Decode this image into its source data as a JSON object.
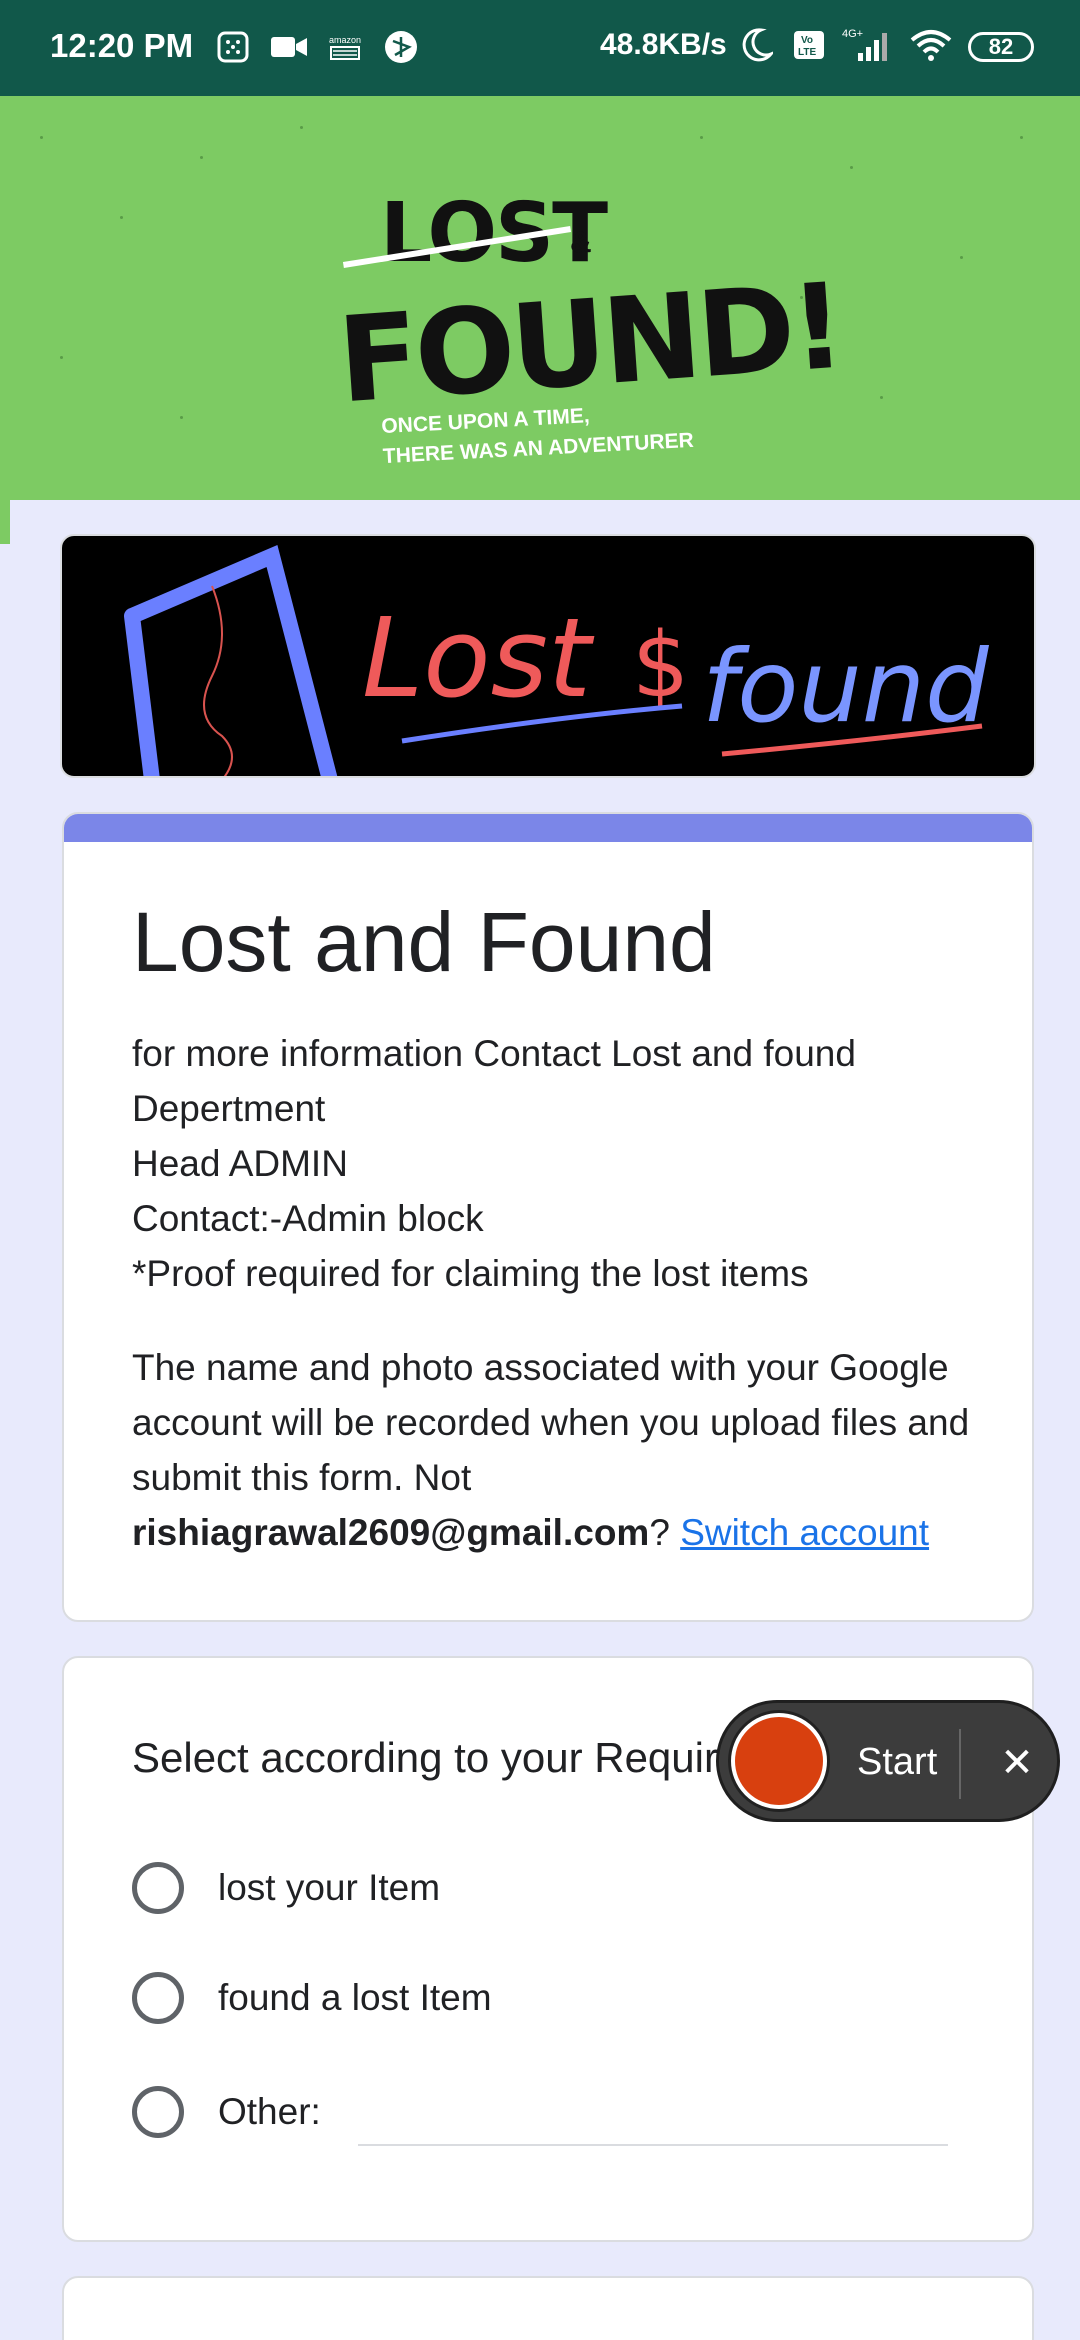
{
  "status_bar": {
    "time": "12:20 PM",
    "network_speed": "48.8KB/s",
    "battery": "82",
    "network_type": "4G+",
    "volte": "Vo LTE",
    "icons_left": [
      "grid-icon",
      "video-icon",
      "amazon-icon",
      "app-icon"
    ],
    "icons_right": [
      "moon-icon",
      "volte-icon",
      "signal-icon",
      "wifi-icon"
    ]
  },
  "banner": {
    "logo_lost": "LOST",
    "logo_amp": "&",
    "logo_found": "FOUND!",
    "tagline_1": "ONCE UPON A TIME,",
    "tagline_2": "THERE WAS AN ADVENTURER",
    "bg_color": "#7dcb63"
  },
  "header_image": {
    "text_lost": "Lost",
    "text_amp": "$",
    "text_found": "found"
  },
  "form": {
    "title": "Lost and Found",
    "description": [
      "for more information Contact Lost and found",
      "Depertment",
      "Head ADMIN",
      "Contact:-Admin block",
      "*Proof required for claiming the lost items"
    ],
    "notice_text": "The name and photo associated with your Google account will be recorded when you upload files and submit this form. Not",
    "account_email": "rishiagrawal2609@gmail.com",
    "question_mark": "?",
    "switch_account": "Switch account",
    "accent_color": "#7b86e8"
  },
  "question": {
    "title": "Select according to your Requirement",
    "options": [
      "lost your Item",
      "found a lost Item",
      "Other:"
    ]
  },
  "recorder": {
    "start_label": "Start",
    "close_label": "✕"
  }
}
